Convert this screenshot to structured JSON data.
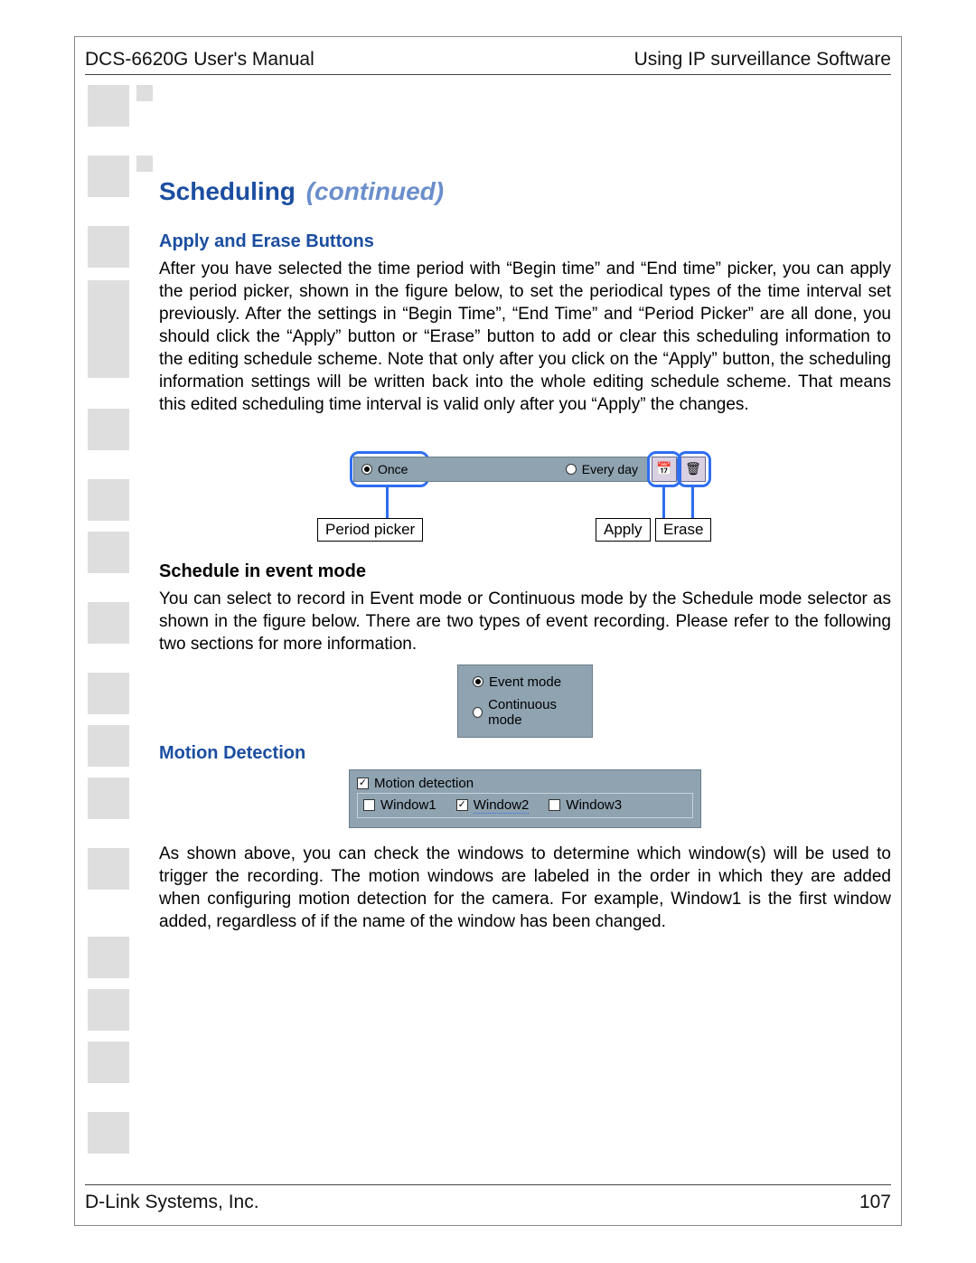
{
  "header": {
    "left": "DCS-6620G User's Manual",
    "right": "Using IP surveillance Software"
  },
  "footer": {
    "left": "D-Link Systems, Inc.",
    "page": "107"
  },
  "title": {
    "main": "Scheduling",
    "cont": "(continued)"
  },
  "section1": {
    "heading": "Apply and Erase Buttons",
    "para": "After you have selected the time period with “Begin time” and “End time” picker, you can apply the period picker, shown in the figure below, to set the periodical types of the time interval set previously. After the settings in “Begin Time”, “End Time” and “Period Picker” are all done, you should click the “Apply” button or “Erase” button to add or clear this scheduling information to the editing schedule scheme. Note that only after you click on the “Apply” button, the scheduling information settings will be written back into the whole editing schedule scheme. That means this edited scheduling time interval is valid only after you “Apply” the changes."
  },
  "fig1": {
    "once": "Once",
    "everyday": "Every day",
    "label_period": "Period picker",
    "label_apply": "Apply",
    "label_erase": "Erase"
  },
  "section2": {
    "heading": "Schedule in event mode",
    "para": "You can select to record in Event mode or Continuous mode by the Schedule mode selector as shown in the figure below. There are two types of event recording. Please refer to the following two sections for more information."
  },
  "fig2": {
    "event": "Event mode",
    "continuous": "Continuous mode",
    "selected": "event"
  },
  "section3": {
    "heading": "Motion Detection"
  },
  "fig3": {
    "group": "Motion detection",
    "group_checked": true,
    "windows": [
      {
        "label": "Window1",
        "checked": false
      },
      {
        "label": "Window2",
        "checked": true
      },
      {
        "label": "Window3",
        "checked": false
      }
    ]
  },
  "section3_para": "As shown above, you can check the windows to determine which window(s) will be used to trigger the recording. The motion windows are labeled in the order in which they are added when configuring motion detection for the camera. For example, Window1 is the first window added, regardless of if the name of the window has been changed."
}
